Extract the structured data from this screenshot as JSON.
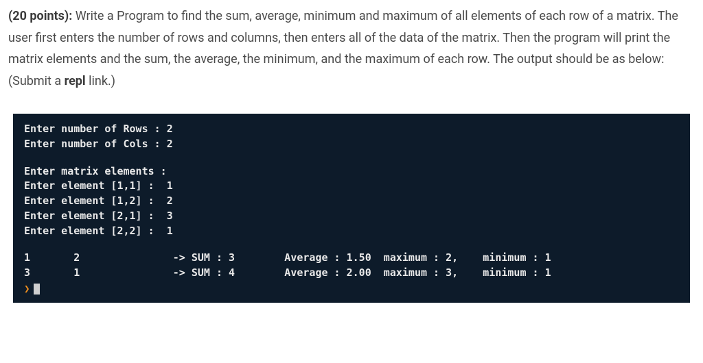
{
  "problem": {
    "points_label": "(20 points): ",
    "text_part1": "Write a Program to find the sum, average, minimum and maximum of all elements of each row of a matrix. The user first enters the number of rows and columns, then enters all of the data of the matrix. Then the program will print the matrix elements and the sum, the average, the minimum, and the maximum of each row. The output should be as below: (Submit a ",
    "repl_word": "repl",
    "text_part2": " link.)"
  },
  "terminal": {
    "rows_prompt": "Enter number of Rows : 2",
    "cols_prompt": "Enter number of Cols : 2",
    "elements_header": "Enter matrix elements :",
    "elem11": "Enter element [1,1] :  1",
    "elem12": "Enter element [1,2] :  2",
    "elem21": "Enter element [2,1] :  3",
    "elem22": "Enter element [2,2] :  1",
    "row1": "1       2               -> SUM : 3        Average : 1.50  maximum : 2,    minimum : 1",
    "row2": "3       1               -> SUM : 4        Average : 2.00  maximum : 3,    minimum : 1"
  }
}
